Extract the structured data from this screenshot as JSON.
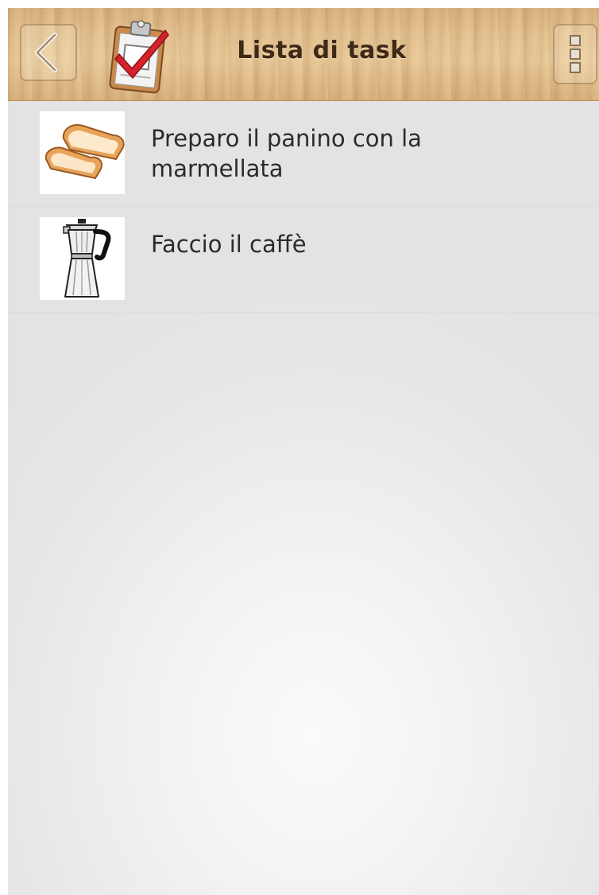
{
  "header": {
    "title": "Lista di task",
    "back_icon": "chevron-left-icon",
    "logo_icon": "clipboard-checkmark-icon",
    "menu_icon": "overflow-menu-icon",
    "accent_color": "#3e2a17",
    "checkmark_color": "#d4232a"
  },
  "tasks": [
    {
      "label": "Preparo il panino con la marmellata",
      "icon": "bread-slices-icon"
    },
    {
      "label": "Faccio il caffè",
      "icon": "moka-pot-icon"
    }
  ]
}
